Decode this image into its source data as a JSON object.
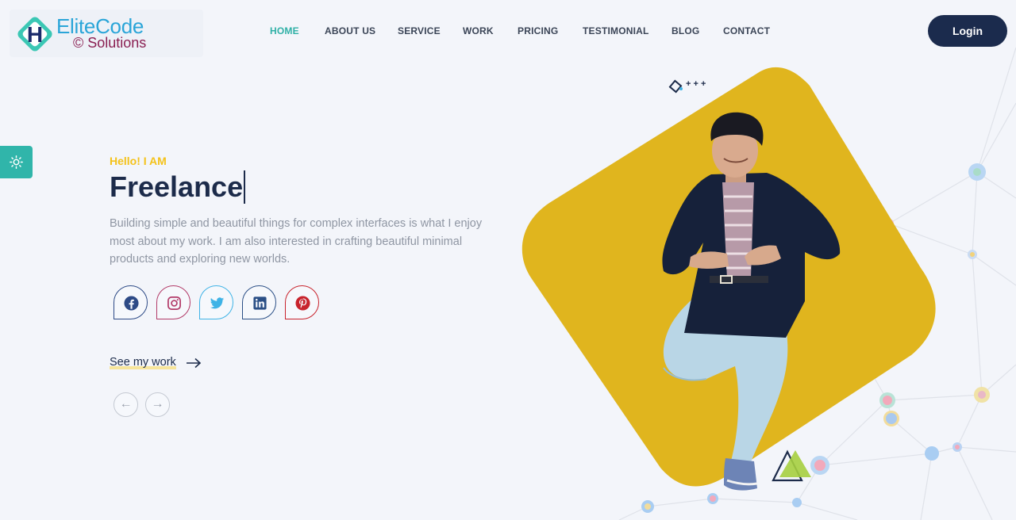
{
  "brand": {
    "name": "EliteCode",
    "sub": "© Solutions",
    "letter": "H"
  },
  "nav": {
    "items": [
      {
        "label": "HOME",
        "active": true
      },
      {
        "label": "ABOUT US",
        "active": false
      },
      {
        "label": "SERVICE",
        "active": false
      },
      {
        "label": "WORK",
        "active": false
      },
      {
        "label": "PRICING",
        "active": false
      },
      {
        "label": "TESTIMONIAL",
        "active": false
      },
      {
        "label": "BLOG",
        "active": false
      },
      {
        "label": "CONTACT",
        "active": false
      }
    ],
    "login_label": "Login"
  },
  "hero": {
    "greeting": "Hello! I AM",
    "headline": "Freelance",
    "intro": "Building simple and beautiful things for complex interfaces is what I enjoy most about my work. I am also interested in crafting beautiful minimal products and exploring new worlds.",
    "cta_label": "See my work",
    "prev_symbol": "←",
    "next_symbol": "→"
  },
  "socials": [
    {
      "icon": "facebook-icon",
      "color": "#2d4a86"
    },
    {
      "icon": "instagram-icon",
      "color": "#b23a68"
    },
    {
      "icon": "twitter-icon",
      "color": "#3fb3e6"
    },
    {
      "icon": "linkedin-icon",
      "color": "#2b4f86"
    },
    {
      "icon": "pinterest-icon",
      "color": "#c8232c"
    }
  ],
  "theme": {
    "accent": "#30b5aa",
    "highlight": "#f4c21a",
    "navy": "#1b2b4d",
    "hero_shape": "#e0b51e"
  }
}
